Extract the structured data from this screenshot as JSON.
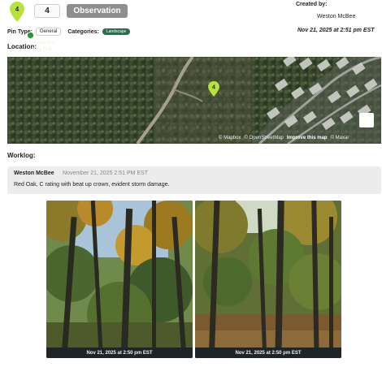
{
  "header": {
    "pin_icon_number": "4",
    "pin_number": "4",
    "type_button": "Observation",
    "created_by_label": "Created by:",
    "created_by_name": "Weston McBee",
    "created_date": "Nov 21, 2025 at 2:51 pm EST"
  },
  "meta": {
    "pin_type_label": "Pin Type:",
    "pin_type_value": "General",
    "categories_label": "Categories:",
    "category_value": "Landscape"
  },
  "location": {
    "label": "Location:",
    "park_label_line1": "Carolina Bay",
    "park_label_line2": "Dog Park",
    "marker_number": "4",
    "attribution": [
      "© Mapbox",
      "© OpenStreetMap",
      "Improve this map",
      "© Maxar"
    ]
  },
  "worklog": {
    "label": "Worklog:",
    "entry": {
      "author": "Weston McBee",
      "date": "November 21, 2025 2:51 PM EST",
      "text": "Red Oak, C rating with beat up crown, evident storm damage."
    },
    "photos": [
      {
        "caption": "Nov 21, 2025 at 2:50 pm EST"
      },
      {
        "caption": "Nov 21, 2025 at 2:50 pm EST"
      }
    ]
  },
  "colors": {
    "pin_green": "#b6e23a",
    "button_gray": "#8e8e8e",
    "tag_green": "#2e6b4f",
    "worklog_bg": "#ececec"
  }
}
